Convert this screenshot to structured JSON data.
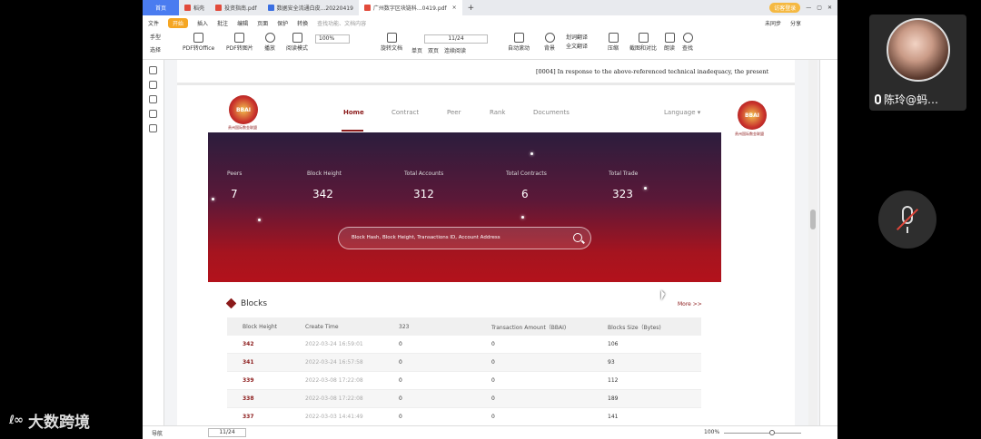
{
  "app": {
    "tabs": [
      {
        "label": "首页"
      },
      {
        "label": "稻壳"
      },
      {
        "label": "投资指南.pdf"
      },
      {
        "label": "数据安全流通白皮...20220419"
      },
      {
        "label": "广州数字区块链科...0419.pdf"
      }
    ],
    "right": {
      "login": "访客登录",
      "sync": "未同步",
      "share": "分享"
    }
  },
  "menu": [
    "文件",
    "开始",
    "插入",
    "批注",
    "编辑",
    "页面",
    "保护",
    "转换",
    "查找功能、文档内容"
  ],
  "toolbar": {
    "items": [
      "手型",
      "选择",
      "PDF转Office",
      "PDF转图片",
      "播放",
      "阅读模式",
      "旋转文档",
      "单页",
      "双页",
      "连续阅读",
      "自动滚动",
      "背景",
      "划词翻译",
      "全文翻译",
      "压缩",
      "截图和对比",
      "朗读",
      "查找"
    ],
    "zoom": "100%",
    "page": "11/24"
  },
  "doc": {
    "top_text": "[0004]   In response to the above-referenced technical inadequacy, the present",
    "site": {
      "logo_text": "BBAI",
      "logo_caption": "贵州国际数金联盟",
      "nav": [
        "Home",
        "Contract",
        "Peer",
        "Rank",
        "Documents"
      ],
      "language": "Language",
      "stats": [
        {
          "label": "Peers",
          "value": "7"
        },
        {
          "label": "Block Height",
          "value": "342"
        },
        {
          "label": "Total Accounts",
          "value": "312"
        },
        {
          "label": "Total Contracts",
          "value": "6"
        },
        {
          "label": "Total Trade",
          "value": "323"
        }
      ],
      "search_placeholder": "Block Hash, Block Height, Transactions ID, Account Address",
      "blocks_title": "Blocks",
      "more": "More >>",
      "headers": [
        "Block Height",
        "Create Time",
        "323",
        "Transaction Amount（BBAI)",
        "Blocks Size（Bytes)"
      ],
      "rows": [
        [
          "342",
          "2022-03-24 16:59:01",
          "0",
          "0",
          "106"
        ],
        [
          "341",
          "2022-03-24 16:57:58",
          "0",
          "0",
          "93"
        ],
        [
          "339",
          "2022-03-08 17:22:08",
          "0",
          "0",
          "112"
        ],
        [
          "338",
          "2022-03-08 17:22:08",
          "0",
          "0",
          "189"
        ],
        [
          "337",
          "2022-03-03 14:41:49",
          "0",
          "0",
          "141"
        ]
      ]
    }
  },
  "status": {
    "label": "导航",
    "page": "11/24",
    "zoom": "100%"
  },
  "meeting": {
    "name": "陈玲@蚂…"
  },
  "watermark": "大数跨境"
}
